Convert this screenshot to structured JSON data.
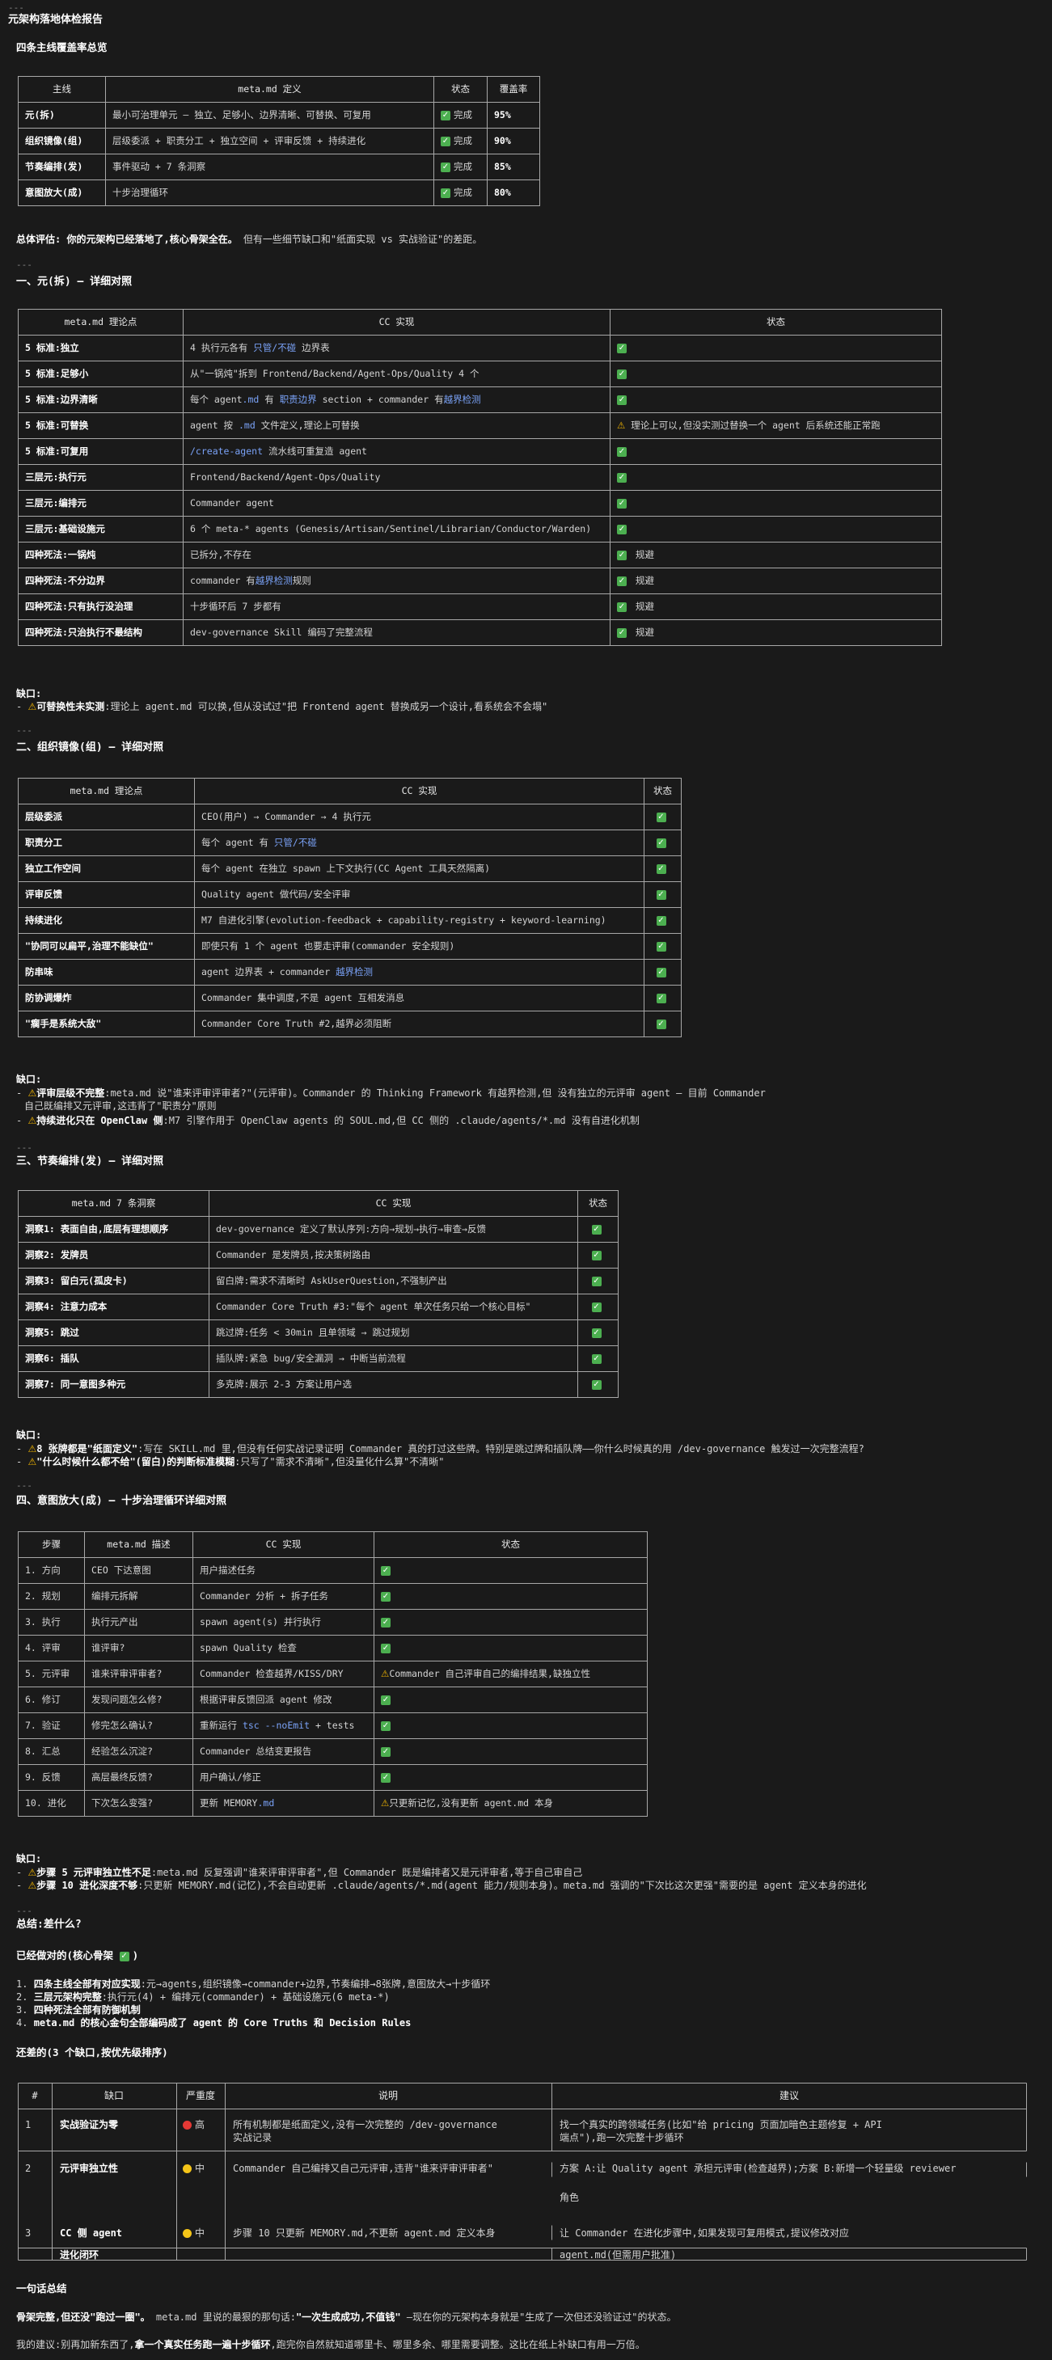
{
  "header": {
    "dashes": "---",
    "title": "元架构落地体检报告",
    "overview_heading": "四条主线覆盖率总览"
  },
  "overview_table": {
    "columns": [
      "主线",
      "meta.md 定义",
      "状态",
      "覆盖率"
    ],
    "rows": [
      [
        "元(拆)",
        "最小可治理单元 — 独立、足够小、边界清晰、可替换、可复用",
        "完成",
        "95%"
      ],
      [
        "组织镜像(组)",
        "层级委派 + 职责分工 + 独立空间 + 评审反馈 + 持续进化",
        "完成",
        "90%"
      ],
      [
        "节奏编排(发)",
        "事件驱动 + 7 条洞察",
        "完成",
        "85%"
      ],
      [
        "意图放大(成)",
        "十步治理循环",
        "完成",
        "80%"
      ]
    ]
  },
  "overall": {
    "label": "总体评估:",
    "bold": "你的元架构已经落地了,核心骨架全在。",
    "rest": " 但有一些细节缺口和\"纸面实现 vs 实战验证\"的差距。"
  },
  "sec1": {
    "dashes": "---",
    "title": "一、元(拆) — 详细对照",
    "columns": [
      "meta.md 理论点",
      "CC 实现",
      "状态"
    ],
    "rows": [
      {
        "k": "5 标准:独立",
        "v": "4 执行元各有 只管/不碰 边界表",
        "s": "",
        "icon": "check"
      },
      {
        "k": "5 标准:足够小",
        "v": "从\"一锅炖\"拆到 Frontend/Backend/Agent-Ops/Quality 4 个",
        "s": "",
        "icon": "check"
      },
      {
        "k": "5 标准:边界清晰",
        "v": "每个 agent.md 有 职责边界 section + commander 有越界检测",
        "s": "",
        "icon": "check"
      },
      {
        "k": "5 标准:可替换",
        "v": "agent 按 .md 文件定义,理论上可替换",
        "s": "理论上可以,但没实测过替换一个 agent 后系统还能正常跑",
        "icon": "warn"
      },
      {
        "k": "5 标准:可复用",
        "v": "/create-agent 流水线可重复造 agent",
        "s": "",
        "icon": "check"
      },
      {
        "k": "三层元:执行元",
        "v": "Frontend/Backend/Agent-Ops/Quality",
        "s": "",
        "icon": "check"
      },
      {
        "k": "三层元:编排元",
        "v": "Commander agent",
        "s": "",
        "icon": "check"
      },
      {
        "k": "三层元:基础设施元",
        "v": "6 个 meta-* agents (Genesis/Artisan/Sentinel/Librarian/Conductor/Warden)",
        "s": "",
        "icon": "check"
      },
      {
        "k": "四种死法:一锅炖",
        "v": "已拆分,不存在",
        "s": "规避",
        "icon": "check"
      },
      {
        "k": "四种死法:不分边界",
        "v": "commander 有越界检测规则",
        "s": "规避",
        "icon": "check"
      },
      {
        "k": "四种死法:只有执行没治理",
        "v": "十步循环后 7 步都有",
        "s": "规避",
        "icon": "check"
      },
      {
        "k": "四种死法:只治执行不最结构",
        "v": "dev-governance Skill 编码了完整流程",
        "s": "规避",
        "icon": "check"
      }
    ],
    "gap_label": "缺口:",
    "gap_items": [
      {
        "bold": "可替换性未实测",
        "text": ":理论上 agent.md 可以换,但从没试过\"把 Frontend agent 替换成另一个设计,看系统会不会塌\""
      }
    ]
  },
  "sec2": {
    "dashes": "---",
    "title": "二、组织镜像(组) — 详细对照",
    "columns": [
      "meta.md 理论点",
      "CC 实现",
      "状态"
    ],
    "rows": [
      {
        "k": "层级委派",
        "v": "CEO(用户) → Commander → 4 执行元"
      },
      {
        "k": "职责分工",
        "v": "每个 agent 有 只管/不碰"
      },
      {
        "k": "独立工作空间",
        "v": "每个 agent 在独立 spawn 上下文执行(CC Agent 工具天然隔离)"
      },
      {
        "k": "评审反馈",
        "v": "Quality agent 做代码/安全评审"
      },
      {
        "k": "持续进化",
        "v": "M7 自进化引擎(evolution-feedback + capability-registry + keyword-learning)"
      },
      {
        "k": "\"协同可以扁平,治理不能缺位\"",
        "v": "即使只有 1 个 agent 也要走评审(commander 安全规则)"
      },
      {
        "k": "防串味",
        "v": "agent 边界表 + commander 越界检测"
      },
      {
        "k": "防协调爆炸",
        "v": "Commander 集中调度,不是 agent 互相发消息"
      },
      {
        "k": "\"瘸手是系统大敌\"",
        "v": "Commander Core Truth #2,越界必须阻断"
      }
    ],
    "gap_label": "缺口:",
    "gap_items": [
      {
        "bold": "评审层级不完整",
        "text": ":meta.md 说\"谁来评审评审者?\"(元评审)。Commander 的 Thinking Framework 有越界检测,但 没有独立的元评审 agent — 目前 Commander",
        "cont": "自己既编排又元评审,这违背了\"职责分\"原则"
      },
      {
        "bold": "持续进化只在 OpenClaw 侧",
        "text": ":M7 引擎作用于 OpenClaw agents 的 SOUL.md,但 CC 侧的 .claude/agents/*.md 没有自进化机制"
      }
    ]
  },
  "sec3": {
    "dashes": "---",
    "title": "三、节奏编排(发) — 详细对照",
    "columns": [
      "meta.md 7 条洞察",
      "CC 实现",
      "状态"
    ],
    "rows": [
      {
        "k": "洞察1: 表面自由,底层有理想顺序",
        "v": "dev-governance 定义了默认序列:方向→规划→执行→审查→反馈"
      },
      {
        "k": "洞察2: 发牌员",
        "v": "Commander 是发牌员,按决策树路由"
      },
      {
        "k": "洞察3: 留白元(孤皮卡)",
        "v": "留白牌:需求不清晰时 AskUserQuestion,不强制产出"
      },
      {
        "k": "洞察4: 注意力成本",
        "v": "Commander Core Truth #3:\"每个 agent 单次任务只给一个核心目标\""
      },
      {
        "k": "洞察5: 跳过",
        "v": "跳过牌:任务 < 30min 且单领域 → 跳过规划"
      },
      {
        "k": "洞察6: 插队",
        "v": "插队牌:紧急 bug/安全漏洞 → 中断当前流程"
      },
      {
        "k": "洞察7: 同一意图多种元",
        "v": "多克牌:展示 2-3 方案让用户选"
      }
    ],
    "gap_label": "缺口:",
    "gap_items": [
      {
        "bold": "8 张牌都是\"纸面定义\"",
        "text": ":写在 SKILL.md 里,但没有任何实战记录证明 Commander 真的打过这些牌。特别是跳过牌和插队牌——你什么时候真的用 /dev-governance 触发过一次完整流程?"
      },
      {
        "bold": "\"什么时候什么都不给\"(留白)的判断标准模糊",
        "text": ":只写了\"需求不清晰\",但没量化什么算\"不清晰\""
      }
    ]
  },
  "sec4": {
    "dashes": "---",
    "title": "四、意图放大(成) — 十步治理循环详细对照",
    "columns": [
      "步骤",
      "meta.md 描述",
      "CC 实现",
      "状态"
    ],
    "rows": [
      {
        "n": "1. 方向",
        "d": "CEO 下达意图",
        "v": "用户描述任务",
        "s": "",
        "icon": "check"
      },
      {
        "n": "2. 规划",
        "d": "编排元拆解",
        "v": "Commander 分析 + 拆子任务",
        "s": "",
        "icon": "check"
      },
      {
        "n": "3. 执行",
        "d": "执行元产出",
        "v": "spawn agent(s) 并行执行",
        "s": "",
        "icon": "check"
      },
      {
        "n": "4. 评审",
        "d": "谁评审?",
        "v": "spawn Quality 检查",
        "s": "",
        "icon": "check"
      },
      {
        "n": "5. 元评审",
        "d": "谁来评审评审者?",
        "v": "Commander 检查越界/KISS/DRY",
        "s": "Commander 自己评审自己的编排结果,缺独立性",
        "icon": "warn"
      },
      {
        "n": "6. 修订",
        "d": "发现问题怎么修?",
        "v": "根据评审反馈回派 agent 修改",
        "s": "",
        "icon": "check"
      },
      {
        "n": "7. 验证",
        "d": "修完怎么确认?",
        "v": "重新运行 tsc --noEmit + tests",
        "s": "",
        "icon": "check"
      },
      {
        "n": "8. 汇总",
        "d": "经验怎么沉淀?",
        "v": "Commander 总结变更报告",
        "s": "",
        "icon": "check"
      },
      {
        "n": "9. 反馈",
        "d": "高层最终反馈?",
        "v": "用户确认/修正",
        "s": "",
        "icon": "check"
      },
      {
        "n": "10. 进化",
        "d": "下次怎么变强?",
        "v": "更新 MEMORY.md",
        "s": "只更新记忆,没有更新 agent.md 本身",
        "icon": "warn"
      }
    ],
    "gap_label": "缺口:",
    "gap_items": [
      {
        "bold": "步骤 5 元评审独立性不足",
        "text": ":meta.md 反复强调\"谁来评审评审者\",但 Commander 既是编排者又是元评审者,等于自己审自己"
      },
      {
        "bold": "步骤 10 进化深度不够",
        "text": ":只更新 MEMORY.md(记忆),不会自动更新 .claude/agents/*.md(agent 能力/规则本身)。meta.md 强调的\"下次比这次更强\"需要的是 agent 定义本身的进化"
      }
    ]
  },
  "summary": {
    "dashes": "---",
    "title": "总结:差什么?",
    "done_title": "已经做对的(核心骨架",
    "done_items": [
      {
        "bold": "四条主线全部有对应实现",
        "text": ":元→agents,组织镜像→commander+边界,节奏编排→8张牌,意图放大→十步循环"
      },
      {
        "bold": "三层元架构完整",
        "text": ":执行元(4) + 编排元(commander) + 基础设施元(6 meta-*)"
      },
      {
        "bold": "四种死法全部有防御机制",
        "text": ""
      },
      {
        "bold": "meta.md 的核心金句全部编码成了 agent 的 Core Truths 和 Decision Rules",
        "text": ""
      }
    ],
    "gaps_title": "还差的(3 个缺口,按优先级排序)",
    "gaps_columns": [
      "#",
      "缺口",
      "严重度",
      "说明",
      "建议"
    ],
    "gaps_rows": [
      {
        "n": "1",
        "g": "实战验证为零",
        "sev": "高",
        "dot": "red",
        "desc1": "所有机制都是纸面定义,没有一次完整的 /dev-governance",
        "desc2": "实战记录",
        "sug1": "找一个真实的跨领域任务(比如\"给 pricing 页面加暗色主题修复 + API",
        "sug2": "端点\"),跑一次完整十步循环"
      },
      {
        "n": "2",
        "g": "元评审独立性",
        "sev": "中",
        "dot": "yel",
        "desc1": "Commander 自己编排又自己元评审,违背\"谁来评审评审者\"",
        "desc2": "",
        "sug1": "方案 A:让 Quality agent 承担元评审(检查越界);方案 B:新增一个轻量级 reviewer",
        "sug2": "角色"
      },
      {
        "n": "3",
        "g": "CC 侧 agent",
        "g2": "进化闭环",
        "sev": "中",
        "dot": "yel",
        "desc1": "步骤 10 只更新 MEMORY.md,不更新 agent.md 定义本身",
        "desc2": "",
        "sug1": "让 Commander 在进化步骤中,如果发现可复用模式,提议修改对应",
        "sug2": "agent.md(但需用户批准)"
      }
    ],
    "final_title": "一句话总结",
    "final_bold1": "骨架完整,但还没\"跑过一圈\"。",
    "final_text1": " meta.md 里说的最狠的那句话:",
    "final_bold2": "\"一次生成成功,不值钱\"",
    "final_text2": " —现在你的元架构本身就是\"生成了一次但还没验证过\"的状态。",
    "advice_label": "我的建议:",
    "advice_text": "别再加新东西了,",
    "advice_bold": "拿一个真实任务跑一遍十步循环",
    "advice_tail": ",跑完你自然就知道哪里卡、哪里多余、哪里需要调整。这比在纸上补缺口有用一万倍。"
  }
}
